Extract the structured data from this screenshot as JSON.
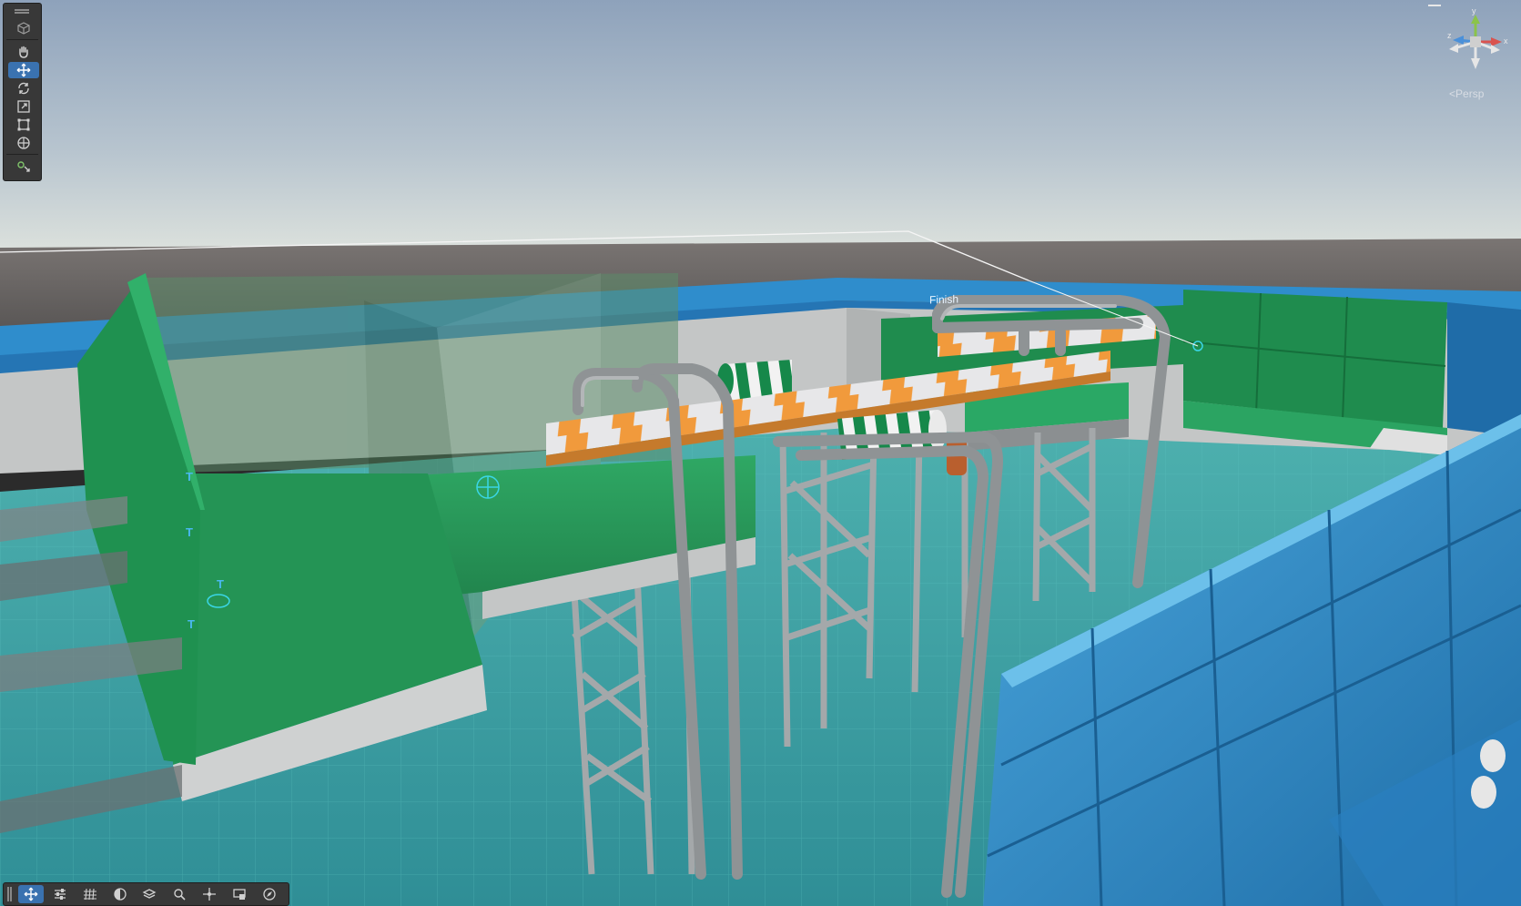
{
  "scene_view": {
    "orientation": {
      "projection_label": "Persp",
      "axes": {
        "y": "y",
        "x": "x",
        "z": "z"
      },
      "axis_colors": {
        "x": "#d9534f",
        "y": "#8bc34a",
        "z": "#4a90d9"
      }
    },
    "world_text": {
      "finish_label": "Finish"
    },
    "tools": [
      {
        "name": "view-tool",
        "icon": "cube-icon"
      },
      {
        "name": "hand-tool",
        "icon": "hand-icon"
      },
      {
        "name": "move-tool",
        "icon": "move-arrows-icon",
        "active": true
      },
      {
        "name": "rotate-tool",
        "icon": "rotate-icon"
      },
      {
        "name": "scale-tool",
        "icon": "scale-icon"
      },
      {
        "name": "rect-tool",
        "icon": "rect-icon"
      },
      {
        "name": "transform-tool",
        "icon": "transform-icon"
      },
      {
        "name": "custom-tool",
        "icon": "custom-tool-icon"
      }
    ],
    "overlay_toolbar": [
      {
        "name": "move-gizmo-button",
        "icon": "move-arrows-icon",
        "active": true
      },
      {
        "name": "pivot-button",
        "icon": "sliders-icon"
      },
      {
        "name": "grid-button",
        "icon": "grid-icon"
      },
      {
        "name": "shading-button",
        "icon": "sphere-icon"
      },
      {
        "name": "layers-button",
        "icon": "layers-icon"
      },
      {
        "name": "search-button",
        "icon": "search-icon"
      },
      {
        "name": "snap-button",
        "icon": "snap-icon"
      },
      {
        "name": "display-button",
        "icon": "display-icon"
      },
      {
        "name": "gizmos-button",
        "icon": "compass-icon"
      }
    ],
    "colors": {
      "sky_top": "#8fa3bd",
      "horizon": "#d2d8d6",
      "water": "#3e9ea1",
      "green_platform": "#2a9a5a",
      "blue_wall": "#2f86c8",
      "orange_stripe": "#f0a040",
      "steel": "#9a9ea0",
      "selection_cyan": "#28d0e0",
      "toolbar_bg": "#383838",
      "active_tool": "#3a72b0"
    }
  }
}
